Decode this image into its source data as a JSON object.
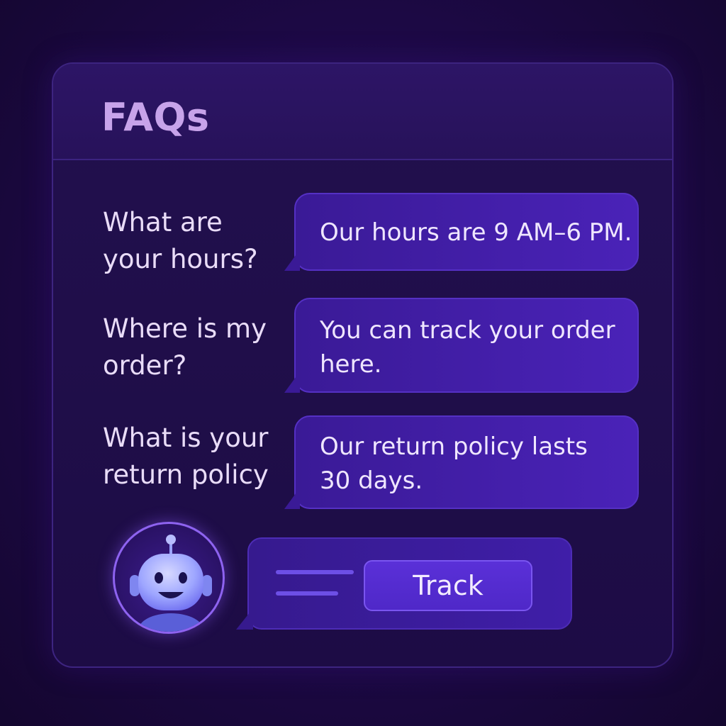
{
  "faq": {
    "title": "FAQs",
    "items": [
      {
        "question": "What are your hours?",
        "answer": "Our hours are 9 AM–6 PM."
      },
      {
        "question": "Where is my order?",
        "answer": "You can track your order here."
      },
      {
        "question": "What is your return policy",
        "answer": "Our return policy lasts 30 days."
      }
    ]
  },
  "bot": {
    "avatar_icon": "robot-icon",
    "action_button_label": "Track"
  },
  "colors": {
    "background": "#1c0944",
    "accent": "#4f28c8",
    "title": "#c7a3ea",
    "bubble": "#4a22b8"
  }
}
